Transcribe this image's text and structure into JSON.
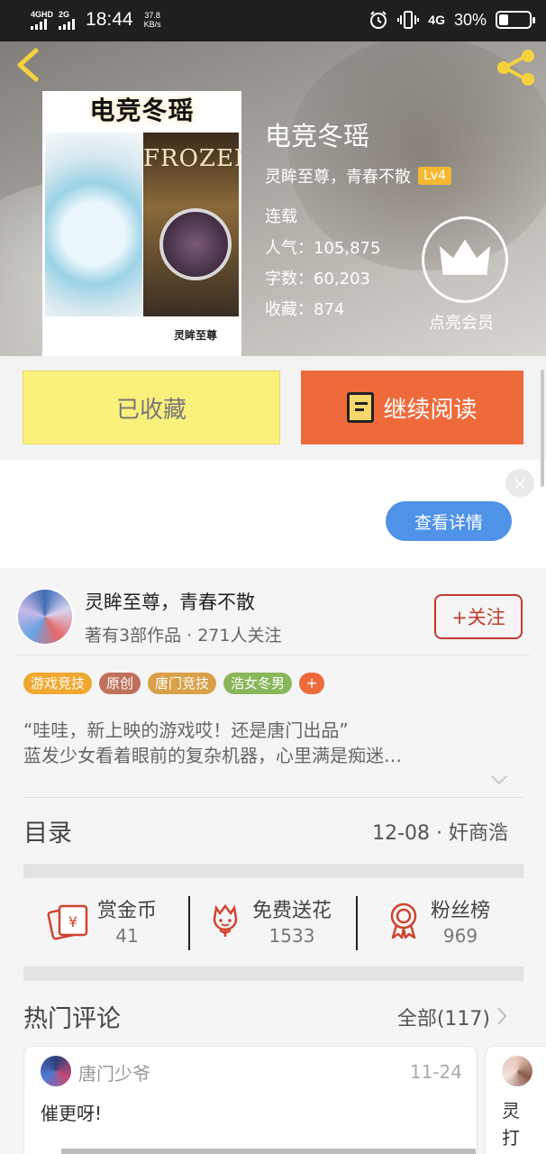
{
  "status_bar": {
    "network1": "4GHD",
    "network2": "2G",
    "time": "18:44",
    "speed_value": "37.8",
    "speed_unit": "KB/s",
    "network_type": "4G",
    "battery": "30%",
    "battery_level": 0.3
  },
  "cover": {
    "title_art": "电竞冬瑶",
    "art_text": "FROZEN",
    "author_art": "灵眸至尊"
  },
  "book": {
    "title": "电竞冬瑶",
    "author": "灵眸至尊，青春不散",
    "level": "Lv4",
    "status": "连载",
    "popularity": "人气：105,875",
    "words": "字数：60,203",
    "favorites": "收藏：874",
    "vip_label": "点亮会员"
  },
  "actions": {
    "collected": "已收藏",
    "continue_read": "继续阅读"
  },
  "ad": {
    "close": "×",
    "detail": "查看详情"
  },
  "author_card": {
    "name": "灵眸至尊，青春不散",
    "meta": "著有3部作品 · 271人关注",
    "follow": "+关注"
  },
  "tags": [
    {
      "label": "游戏竞技",
      "color": "#f0a830"
    },
    {
      "label": "原创",
      "color": "#c0705a"
    },
    {
      "label": "唐门竞技",
      "color": "#d9a048"
    },
    {
      "label": "浩女冬男",
      "color": "#8ab65a"
    }
  ],
  "tag_more": "+",
  "intro": {
    "line1": "“哇哇，新上映的游戏哎！还是唐门出品”",
    "line2": "蓝发少女看着眼前的复杂机器，心里满是痴迷…"
  },
  "toc": {
    "label": "目录",
    "latest": "12-08 · 奸商浩"
  },
  "tools": {
    "reward": {
      "label": "赏金币",
      "value": "41"
    },
    "flower": {
      "label": "免费送花",
      "value": "1533"
    },
    "fans": {
      "label": "粉丝榜",
      "value": "969"
    }
  },
  "comments": {
    "label": "热门评论",
    "all": "全部(117)",
    "items": [
      {
        "user": "唐门少爷",
        "date": "11-24",
        "text": "催更呀!"
      },
      {
        "text": "灵\n打"
      }
    ]
  },
  "colors": {
    "accent_orange": "#ef6a3a",
    "collected_yellow": "#faf07c",
    "follow_red": "#c33a2e",
    "detail_blue": "#4f93e8"
  }
}
